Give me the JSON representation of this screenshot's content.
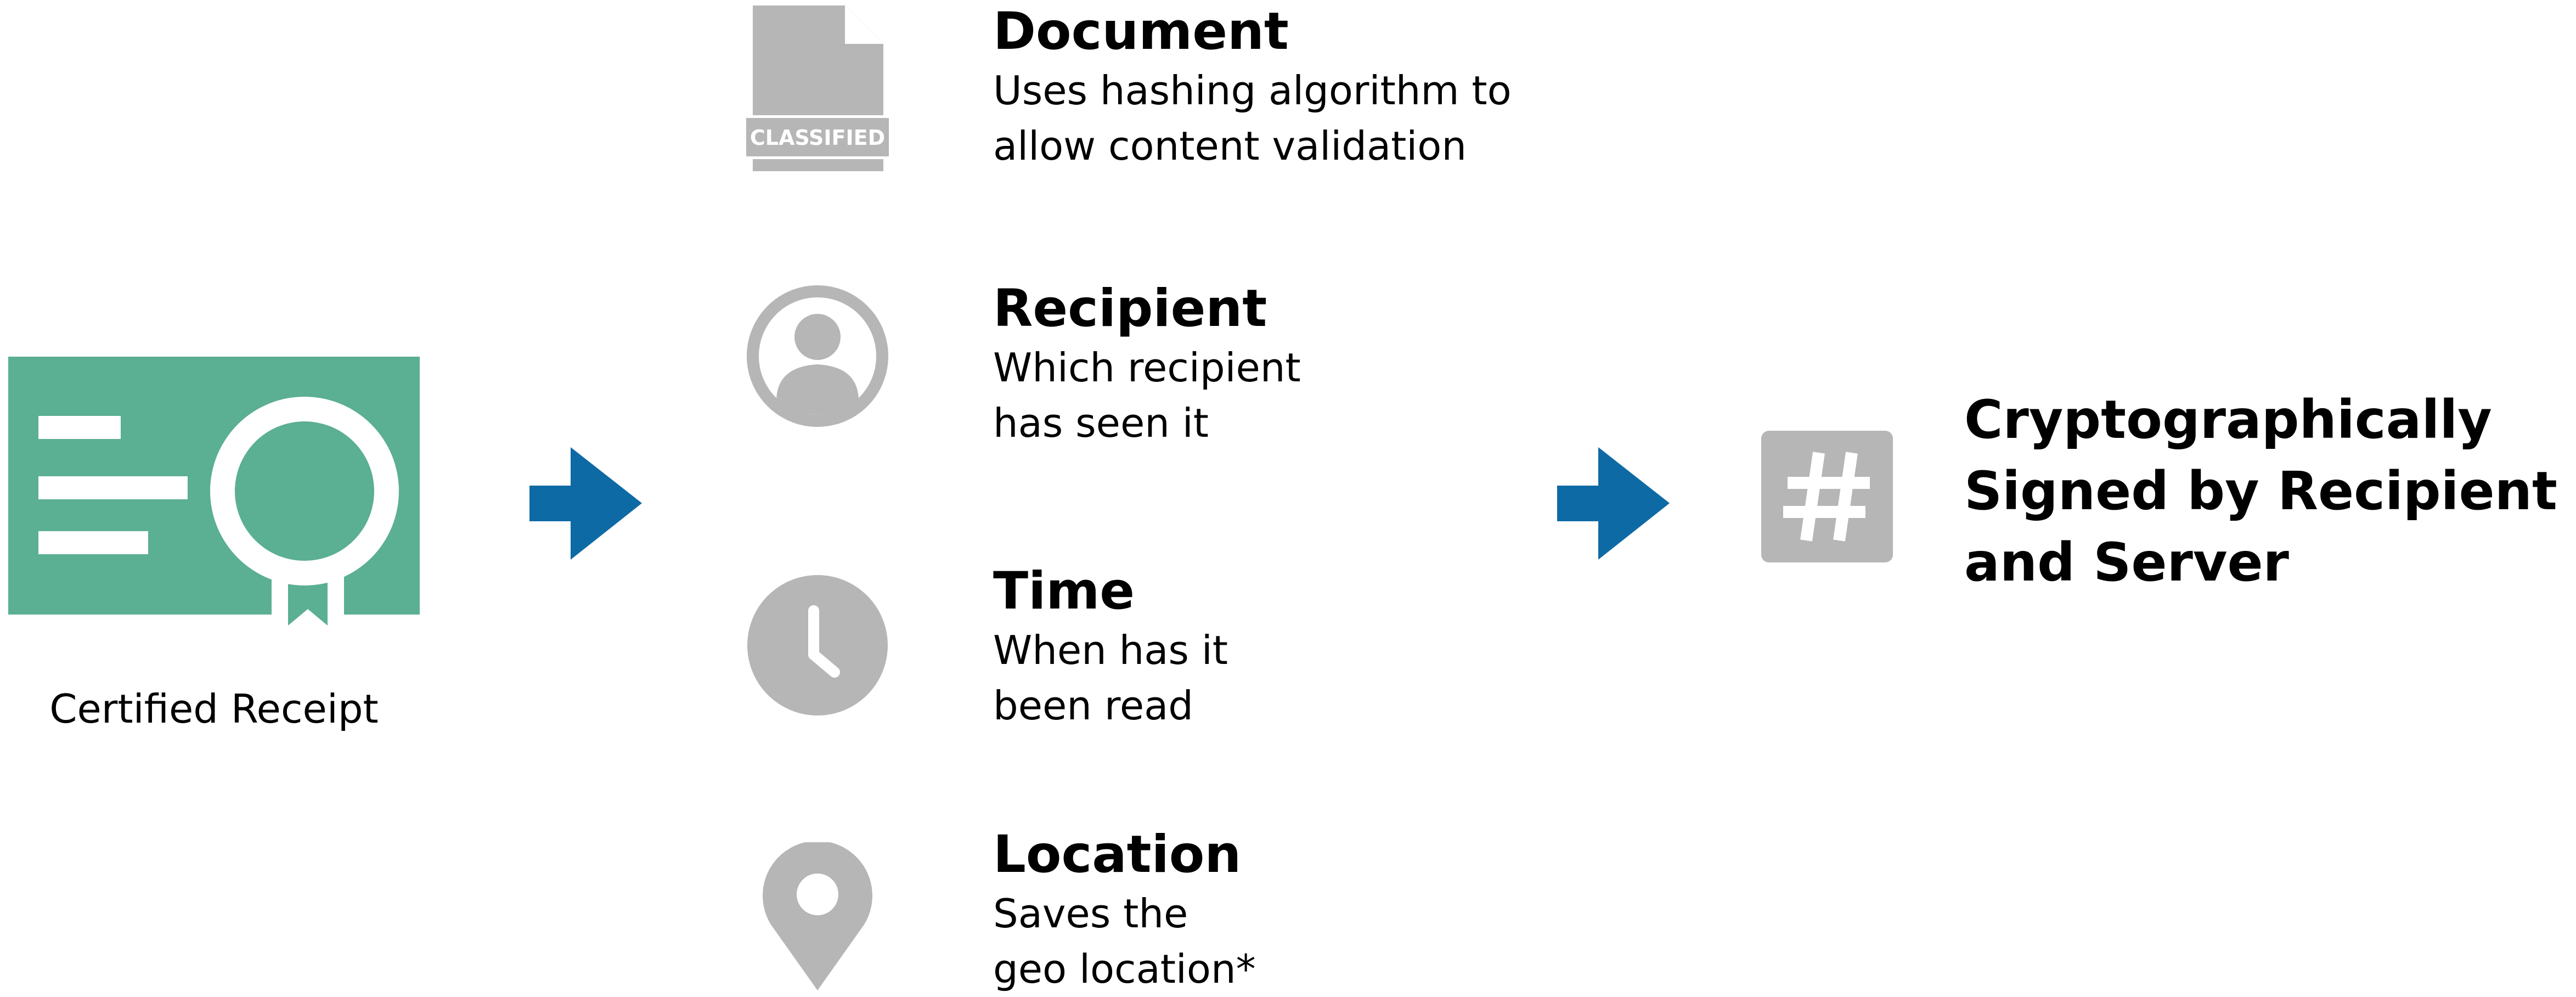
{
  "colors": {
    "receipt_green": "#5BAF92",
    "arrow_blue": "#0E6AA4",
    "icon_gray": "#B6B6B6",
    "text": "#000000",
    "background": "#FFFFFF"
  },
  "receipt": {
    "icon": "certificate-icon",
    "label": "Certified Receipt"
  },
  "items": [
    {
      "icon": "classified-document-icon",
      "icon_text": "CLASSIFIED",
      "title": "Document",
      "description": "Uses hashing algorithm to\nallow content validation"
    },
    {
      "icon": "user-circle-icon",
      "title": "Recipient",
      "description": "Which recipient\nhas seen it"
    },
    {
      "icon": "clock-icon",
      "title": "Time",
      "description": "When has it\nbeen read"
    },
    {
      "icon": "map-pin-icon",
      "title": "Location",
      "description": "Saves the\ngeo location*"
    }
  ],
  "result": {
    "icon": "hash-icon",
    "text": "Cryptographically\nSigned by Recipient\nand Server"
  }
}
